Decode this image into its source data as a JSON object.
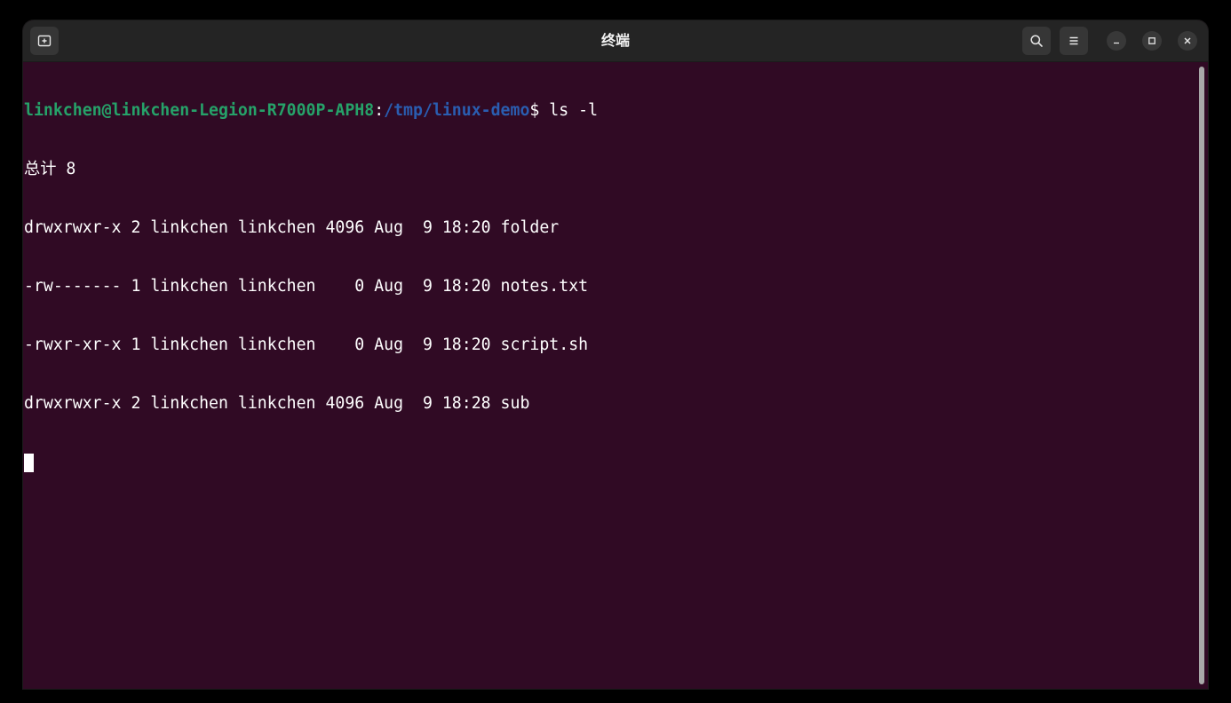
{
  "window": {
    "title": "终端"
  },
  "titlebar": {
    "new_tab_icon": "new-tab-icon",
    "search_icon": "search-icon",
    "menu_icon": "hamburger-menu-icon",
    "minimize_icon": "minimize-icon",
    "maximize_icon": "maximize-icon",
    "close_icon": "close-icon"
  },
  "terminal": {
    "prompt": {
      "user_host": "linkchen@linkchen-Legion-R7000P-APH8",
      "separator": ":",
      "path": "/tmp/linux-demo",
      "symbol": "$",
      "command": " ls -l"
    },
    "output_lines": [
      "总计 8",
      "drwxrwxr-x 2 linkchen linkchen 4096 Aug  9 18:20 folder",
      "-rw------- 1 linkchen linkchen    0 Aug  9 18:20 notes.txt",
      "-rwxr-xr-x 1 linkchen linkchen    0 Aug  9 18:20 script.sh",
      "drwxrwxr-x 2 linkchen linkchen 4096 Aug  9 18:28 sub"
    ]
  },
  "colors": {
    "terminal_bg": "#300a24",
    "titlebar_bg": "#242424",
    "prompt_user": "#26a269",
    "prompt_path": "#2a5db0",
    "text": "#ffffff"
  }
}
